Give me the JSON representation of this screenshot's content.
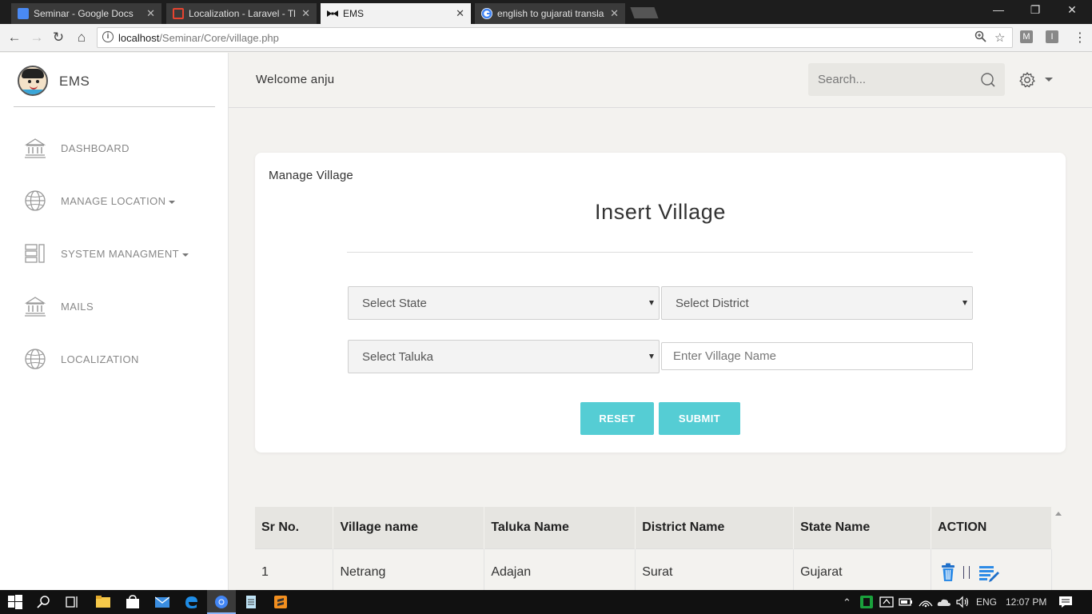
{
  "browser": {
    "tabs": [
      {
        "title": "Seminar - Google Docs",
        "icon_color": "#4a8af4",
        "active": false
      },
      {
        "title": "Localization - Laravel - Tl",
        "icon_color": "#e74430",
        "active": false
      },
      {
        "title": "EMS",
        "icon_color": "#111111",
        "active": true
      },
      {
        "title": "english to gujarati transla",
        "icon_color": "#ffffff",
        "active": false
      }
    ],
    "url_host": "localhost",
    "url_path": "/Seminar/Core/village.php",
    "extensions": [
      "M",
      "I"
    ]
  },
  "app": {
    "brand": "EMS",
    "welcome": "Welcome anju",
    "search_placeholder": "Search...",
    "accent_color": "#55cdd4"
  },
  "sidebar": {
    "items": [
      {
        "label": "DASHBOARD",
        "icon": "bank-icon",
        "caret": false
      },
      {
        "label": "MANAGE LOCATION",
        "icon": "globe-icon",
        "caret": true
      },
      {
        "label": "SYSTEM MANAGMENT",
        "icon": "server-icon",
        "caret": true
      },
      {
        "label": "MAILS",
        "icon": "bank-icon",
        "caret": false
      },
      {
        "label": "LOCALIZATION",
        "icon": "globe-icon",
        "caret": false
      }
    ]
  },
  "form": {
    "card_title": "Manage Village",
    "heading": "Insert Village",
    "state_select": "Select State",
    "district_select": "Select District",
    "taluka_select": "Select Taluka",
    "village_placeholder": "Enter Village Name",
    "reset_label": "RESET",
    "submit_label": "SUBMIT"
  },
  "table": {
    "headers": [
      "Sr No.",
      "Village name",
      "Taluka Name",
      "District Name",
      "State Name",
      "ACTION"
    ],
    "rows": [
      {
        "sr": "1",
        "village": "Netrang",
        "taluka": "Adajan",
        "district": "Surat",
        "state": "Gujarat"
      }
    ]
  },
  "taskbar": {
    "language": "ENG",
    "time": "12:07 PM"
  }
}
